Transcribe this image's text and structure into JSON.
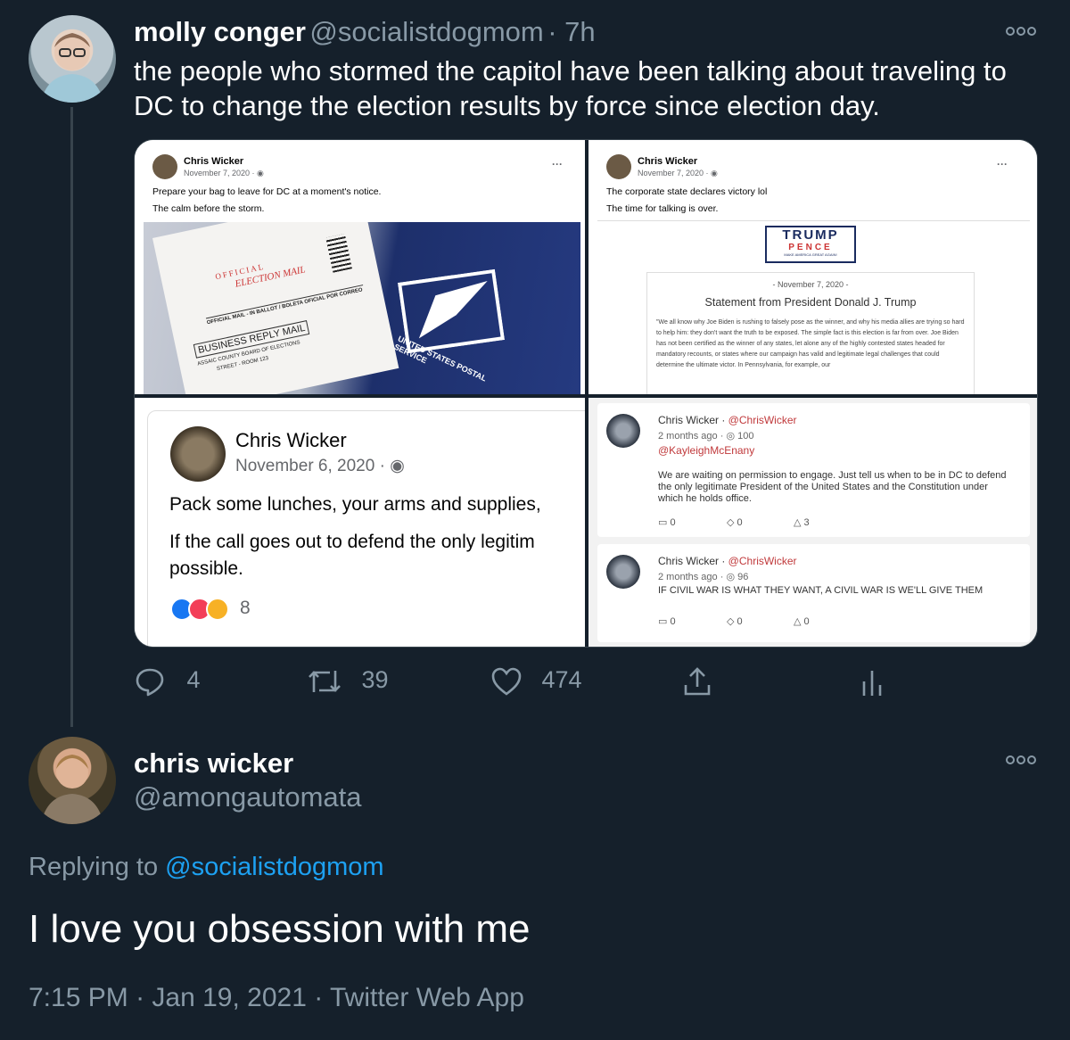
{
  "tweet": {
    "author_name": "molly conger",
    "author_handle": "@socialistdogmom",
    "time": "7h",
    "text_line1": "the people who stormed the capitol have been talking about traveling to",
    "text_line2": "DC to change the election results by force since election day.",
    "more_icon": "more-dots-icon",
    "actions": {
      "reply_count": "4",
      "retweet_count": "39",
      "like_count": "474"
    }
  },
  "media": {
    "post1": {
      "name": "Chris Wicker",
      "date": "November 7, 2020 · ",
      "line1": "Prepare your bag to leave for DC at a moment's notice.",
      "line2": "The calm before the storm.",
      "envelope": {
        "official": "OFFICIAL",
        "election_mail": "ELECTION MAIL",
        "mail_in": "OFFICIAL MAIL - IN BALLOT / BOLETA OFICIAL POR CORREO",
        "business_reply": "BUSINESS REPLY MAIL",
        "county": "ASSAIC COUNTY BOARD OF ELECTIONS",
        "street": "STREET - ROOM 123",
        "usps": "UNITED STATES POSTAL SERVICE"
      }
    },
    "post2": {
      "name": "Chris Wicker",
      "date": "November 7, 2020 · ",
      "line1": "The corporate state declares victory lol",
      "line2": "The time for talking is over.",
      "logo_trump": "TRUMP",
      "logo_pence": "PENCE",
      "logo_tag": "MAKE AMERICA GREAT AGAIN!",
      "doc_date": "- November 7, 2020 -",
      "doc_title": "Statement from President Donald J. Trump",
      "doc_body": "\"We all know why Joe Biden is rushing to falsely pose as the winner, and why his media allies are trying so hard to help him: they don't want the truth to be exposed. The simple fact is this election is far from over. Joe Biden has not been certified as the winner of any states, let alone any of the highly contested states headed for mandatory recounts, or states where our campaign has valid and legitimate legal challenges that could determine the ultimate victor. In Pennsylvania, for example, our"
    },
    "post3": {
      "name": "Chris Wicker",
      "date": "November 6, 2020 · ",
      "line1": "Pack some lunches, your arms and supplies,",
      "line2": "If the call goes out to defend the only legitim",
      "line3": "possible.",
      "reaction_count": "8"
    },
    "post4": {
      "item1": {
        "name": "Chris Wicker",
        "handle": "@ChrisWicker",
        "meta": "2 months ago · ",
        "views": "100",
        "mention": "@KayleighMcEnany",
        "text": "We are waiting on permission to engage. Just tell us when to be in DC to defend the only legitimate President of the United States and the Constitution under which he holds office.",
        "comments": "0",
        "reposts": "0",
        "upvotes": "3"
      },
      "item2": {
        "name": "Chris Wicker",
        "handle": "@ChrisWicker",
        "meta": "2 months ago · ",
        "views": "96",
        "text": "IF CIVIL WAR IS WHAT THEY WANT, A CIVIL WAR IS WE'LL GIVE THEM",
        "comments": "0",
        "reposts": "0",
        "upvotes": "0"
      }
    }
  },
  "reply": {
    "author_name": "chris wicker",
    "author_handle": "@amongautomata",
    "replying_prefix": "Replying to ",
    "replying_handle": "@socialistdogmom",
    "text": "I love you obsession with me",
    "time": "7:15 PM",
    "date": "Jan 19, 2021",
    "source": "Twitter Web App",
    "sep": " · "
  },
  "colors": {
    "background": "#15202b",
    "muted": "#8899a6",
    "link": "#1da1f2"
  }
}
